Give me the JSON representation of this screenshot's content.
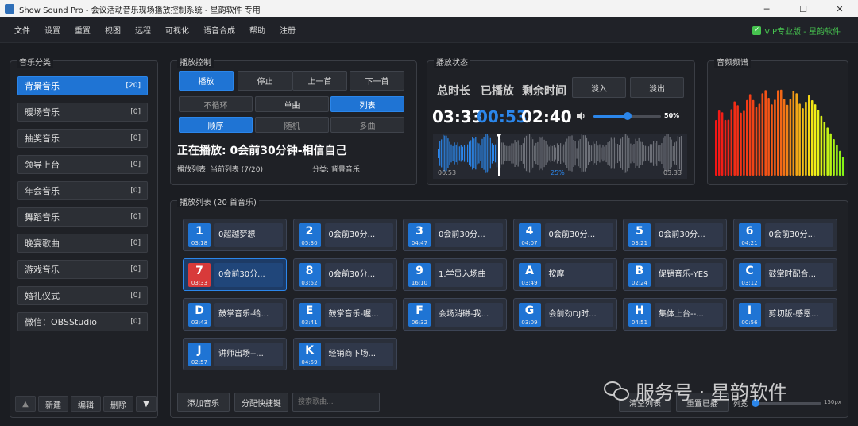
{
  "window": {
    "title": "Show Sound Pro - 会议活动音乐现场播放控制系统 - 星韵软件 专用"
  },
  "menu": {
    "items": [
      "文件",
      "设置",
      "重置",
      "视图",
      "远程",
      "可视化",
      "语音合成",
      "帮助",
      "注册"
    ],
    "vip_label": "VIP专业版 - 星韵软件"
  },
  "categories": {
    "title": "音乐分类",
    "items": [
      {
        "label": "背景音乐",
        "count": "[20]",
        "active": true
      },
      {
        "label": "暖场音乐",
        "count": "[0]",
        "active": false
      },
      {
        "label": "抽奖音乐",
        "count": "[0]",
        "active": false
      },
      {
        "label": "领导上台",
        "count": "[0]",
        "active": false
      },
      {
        "label": "年会音乐",
        "count": "[0]",
        "active": false
      },
      {
        "label": "舞蹈音乐",
        "count": "[0]",
        "active": false
      },
      {
        "label": "晚宴歌曲",
        "count": "[0]",
        "active": false
      },
      {
        "label": "游戏音乐",
        "count": "[0]",
        "active": false
      },
      {
        "label": "婚礼仪式",
        "count": "[0]",
        "active": false
      },
      {
        "label": "微信：OBSStudio",
        "count": "[0]",
        "active": false
      }
    ],
    "tools": {
      "up": "▲",
      "new": "新建",
      "edit": "编辑",
      "delete": "删除",
      "down": "▼"
    }
  },
  "control": {
    "title": "播放控制",
    "play": "播放",
    "stop": "停止",
    "prev": "上一首",
    "next": "下一首",
    "no_loop": "不循环",
    "single": "单曲",
    "list": "列表",
    "sequential": "顺序",
    "random": "随机",
    "multi": "多曲",
    "now_playing": "正在播放: 0会前30分钟-相信自己",
    "playlist_info": "播放列表: 当前列表 (7/20)",
    "category_info": "分类: 背景音乐"
  },
  "status": {
    "title": "播放状态",
    "total_label": "总时长",
    "played_label": "已播放",
    "remaining_label": "剩余时间",
    "fade_in": "淡入",
    "fade_out": "淡出",
    "total": "03:33",
    "played": "00:53",
    "remaining": "02:40",
    "volume_percent": 50,
    "volume_label": "50%",
    "wave_start": "00:53",
    "wave_end": "03:33",
    "progress_label": "25%",
    "progress_fraction": 0.25,
    "speaker_icon": "speaker-icon"
  },
  "spectrum": {
    "title": "音频频谱"
  },
  "playlist": {
    "title": "播放列表 (20 首音乐)",
    "tracks": [
      {
        "id": "1",
        "duration": "03:18",
        "name": "0超越梦想"
      },
      {
        "id": "2",
        "duration": "05:30",
        "name": "0会前30分..."
      },
      {
        "id": "3",
        "duration": "04:47",
        "name": "0会前30分..."
      },
      {
        "id": "4",
        "duration": "04:07",
        "name": "0会前30分..."
      },
      {
        "id": "5",
        "duration": "03:21",
        "name": "0会前30分..."
      },
      {
        "id": "6",
        "duration": "04:21",
        "name": "0会前30分..."
      },
      {
        "id": "7",
        "duration": "03:33",
        "name": "0会前30分...",
        "playing": true
      },
      {
        "id": "8",
        "duration": "03:52",
        "name": "0会前30分..."
      },
      {
        "id": "9",
        "duration": "16:10",
        "name": "1.学员入场曲"
      },
      {
        "id": "A",
        "duration": "03:49",
        "name": "按摩"
      },
      {
        "id": "B",
        "duration": "02:24",
        "name": "促销音乐-YES"
      },
      {
        "id": "C",
        "duration": "03:12",
        "name": "鼓掌时配合..."
      },
      {
        "id": "D",
        "duration": "03:43",
        "name": "鼓掌音乐-给..."
      },
      {
        "id": "E",
        "duration": "03:41",
        "name": "鼓掌音乐-喔..."
      },
      {
        "id": "F",
        "duration": "06:32",
        "name": "会场消磁-我..."
      },
      {
        "id": "G",
        "duration": "03:09",
        "name": "会前劲DJ时..."
      },
      {
        "id": "H",
        "duration": "04:51",
        "name": "集体上台-‐..."
      },
      {
        "id": "I",
        "duration": "00:56",
        "name": "剪切版-感恩..."
      },
      {
        "id": "J",
        "duration": "02:57",
        "name": "讲师出场-‐..."
      },
      {
        "id": "K",
        "duration": "04:59",
        "name": "经销商下场..."
      }
    ],
    "add": "添加音乐",
    "assign_hotkey": "分配快捷键",
    "search_placeholder": "搜索歌曲...",
    "clear": "清空列表",
    "reset_played": "重置已播",
    "width_label": "列宽",
    "width_value": "150px"
  },
  "watermark": {
    "text": "服务号 · 星韵软件"
  }
}
